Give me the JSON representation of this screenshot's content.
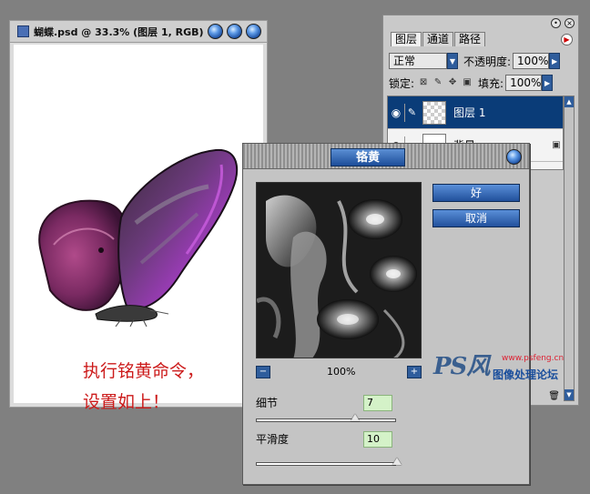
{
  "document": {
    "title": "蝴蝶.psd @ 33.3% (图层 1, RGB)",
    "caption_line1": "执行铭黄命令，",
    "caption_line2": "设置如上！"
  },
  "layers_panel": {
    "tabs": [
      "图层",
      "通道",
      "路径"
    ],
    "blend_mode": "正常",
    "opacity_label": "不透明度:",
    "opacity_value": "100%",
    "lock_label": "锁定:",
    "fill_label": "填充:",
    "fill_value": "100%",
    "layers": [
      {
        "name": "图层 1",
        "selected": true
      },
      {
        "name": "背景",
        "selected": false
      }
    ]
  },
  "chrome_dialog": {
    "title": "铬黄",
    "ok_label": "好",
    "cancel_label": "取消",
    "zoom": "100%",
    "detail_label": "细节",
    "detail_value": "7",
    "detail_max": 10,
    "smoothness_label": "平滑度",
    "smoothness_value": "10",
    "smoothness_max": 10
  },
  "watermark": {
    "url": "www.psfeng.cn",
    "forum": "图像处理论坛"
  },
  "colors": {
    "accent_blue": "#2f5d9c",
    "caption_red": "#cc1a1a",
    "layer_selected": "#0a3c78"
  }
}
